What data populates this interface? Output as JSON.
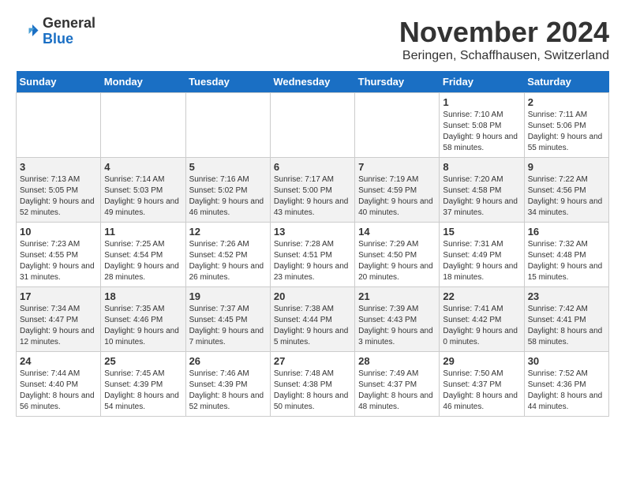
{
  "header": {
    "logo_general": "General",
    "logo_blue": "Blue",
    "month_title": "November 2024",
    "location": "Beringen, Schaffhausen, Switzerland"
  },
  "days_of_week": [
    "Sunday",
    "Monday",
    "Tuesday",
    "Wednesday",
    "Thursday",
    "Friday",
    "Saturday"
  ],
  "weeks": [
    [
      {
        "day": "",
        "info": ""
      },
      {
        "day": "",
        "info": ""
      },
      {
        "day": "",
        "info": ""
      },
      {
        "day": "",
        "info": ""
      },
      {
        "day": "",
        "info": ""
      },
      {
        "day": "1",
        "info": "Sunrise: 7:10 AM\nSunset: 5:08 PM\nDaylight: 9 hours and 58 minutes."
      },
      {
        "day": "2",
        "info": "Sunrise: 7:11 AM\nSunset: 5:06 PM\nDaylight: 9 hours and 55 minutes."
      }
    ],
    [
      {
        "day": "3",
        "info": "Sunrise: 7:13 AM\nSunset: 5:05 PM\nDaylight: 9 hours and 52 minutes."
      },
      {
        "day": "4",
        "info": "Sunrise: 7:14 AM\nSunset: 5:03 PM\nDaylight: 9 hours and 49 minutes."
      },
      {
        "day": "5",
        "info": "Sunrise: 7:16 AM\nSunset: 5:02 PM\nDaylight: 9 hours and 46 minutes."
      },
      {
        "day": "6",
        "info": "Sunrise: 7:17 AM\nSunset: 5:00 PM\nDaylight: 9 hours and 43 minutes."
      },
      {
        "day": "7",
        "info": "Sunrise: 7:19 AM\nSunset: 4:59 PM\nDaylight: 9 hours and 40 minutes."
      },
      {
        "day": "8",
        "info": "Sunrise: 7:20 AM\nSunset: 4:58 PM\nDaylight: 9 hours and 37 minutes."
      },
      {
        "day": "9",
        "info": "Sunrise: 7:22 AM\nSunset: 4:56 PM\nDaylight: 9 hours and 34 minutes."
      }
    ],
    [
      {
        "day": "10",
        "info": "Sunrise: 7:23 AM\nSunset: 4:55 PM\nDaylight: 9 hours and 31 minutes."
      },
      {
        "day": "11",
        "info": "Sunrise: 7:25 AM\nSunset: 4:54 PM\nDaylight: 9 hours and 28 minutes."
      },
      {
        "day": "12",
        "info": "Sunrise: 7:26 AM\nSunset: 4:52 PM\nDaylight: 9 hours and 26 minutes."
      },
      {
        "day": "13",
        "info": "Sunrise: 7:28 AM\nSunset: 4:51 PM\nDaylight: 9 hours and 23 minutes."
      },
      {
        "day": "14",
        "info": "Sunrise: 7:29 AM\nSunset: 4:50 PM\nDaylight: 9 hours and 20 minutes."
      },
      {
        "day": "15",
        "info": "Sunrise: 7:31 AM\nSunset: 4:49 PM\nDaylight: 9 hours and 18 minutes."
      },
      {
        "day": "16",
        "info": "Sunrise: 7:32 AM\nSunset: 4:48 PM\nDaylight: 9 hours and 15 minutes."
      }
    ],
    [
      {
        "day": "17",
        "info": "Sunrise: 7:34 AM\nSunset: 4:47 PM\nDaylight: 9 hours and 12 minutes."
      },
      {
        "day": "18",
        "info": "Sunrise: 7:35 AM\nSunset: 4:46 PM\nDaylight: 9 hours and 10 minutes."
      },
      {
        "day": "19",
        "info": "Sunrise: 7:37 AM\nSunset: 4:45 PM\nDaylight: 9 hours and 7 minutes."
      },
      {
        "day": "20",
        "info": "Sunrise: 7:38 AM\nSunset: 4:44 PM\nDaylight: 9 hours and 5 minutes."
      },
      {
        "day": "21",
        "info": "Sunrise: 7:39 AM\nSunset: 4:43 PM\nDaylight: 9 hours and 3 minutes."
      },
      {
        "day": "22",
        "info": "Sunrise: 7:41 AM\nSunset: 4:42 PM\nDaylight: 9 hours and 0 minutes."
      },
      {
        "day": "23",
        "info": "Sunrise: 7:42 AM\nSunset: 4:41 PM\nDaylight: 8 hours and 58 minutes."
      }
    ],
    [
      {
        "day": "24",
        "info": "Sunrise: 7:44 AM\nSunset: 4:40 PM\nDaylight: 8 hours and 56 minutes."
      },
      {
        "day": "25",
        "info": "Sunrise: 7:45 AM\nSunset: 4:39 PM\nDaylight: 8 hours and 54 minutes."
      },
      {
        "day": "26",
        "info": "Sunrise: 7:46 AM\nSunset: 4:39 PM\nDaylight: 8 hours and 52 minutes."
      },
      {
        "day": "27",
        "info": "Sunrise: 7:48 AM\nSunset: 4:38 PM\nDaylight: 8 hours and 50 minutes."
      },
      {
        "day": "28",
        "info": "Sunrise: 7:49 AM\nSunset: 4:37 PM\nDaylight: 8 hours and 48 minutes."
      },
      {
        "day": "29",
        "info": "Sunrise: 7:50 AM\nSunset: 4:37 PM\nDaylight: 8 hours and 46 minutes."
      },
      {
        "day": "30",
        "info": "Sunrise: 7:52 AM\nSunset: 4:36 PM\nDaylight: 8 hours and 44 minutes."
      }
    ]
  ]
}
